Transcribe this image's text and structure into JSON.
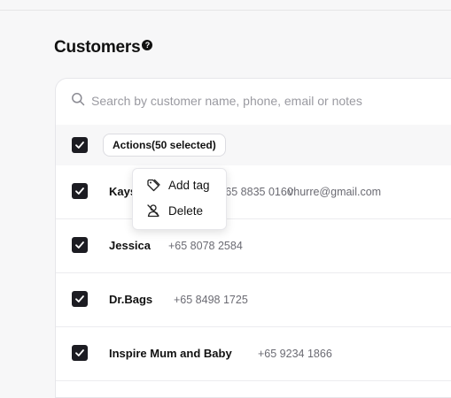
{
  "page": {
    "title": "Customers",
    "help_glyph": "?"
  },
  "search": {
    "placeholder": "Search by customer name, phone, email or notes"
  },
  "bulk": {
    "actions_label": "Actions(50 selected)"
  },
  "menu": {
    "items": [
      {
        "label": "Add tag",
        "icon": "tag-icon"
      },
      {
        "label": "Delete",
        "icon": "delete-user-icon"
      }
    ]
  },
  "customers": [
    {
      "name": "Kays",
      "phone": "+65 8835 0160",
      "email": "vhurre@gmail.com"
    },
    {
      "name": "Jessica",
      "phone": "+65 8078 2584"
    },
    {
      "name": "Dr.Bags",
      "phone": "+65 8498 1725"
    },
    {
      "name": "Inspire Mum and Baby",
      "phone": "+65 9234 1866"
    }
  ],
  "colors": {
    "checkbox": "#1c1c22",
    "background": "#f7f7f8"
  }
}
